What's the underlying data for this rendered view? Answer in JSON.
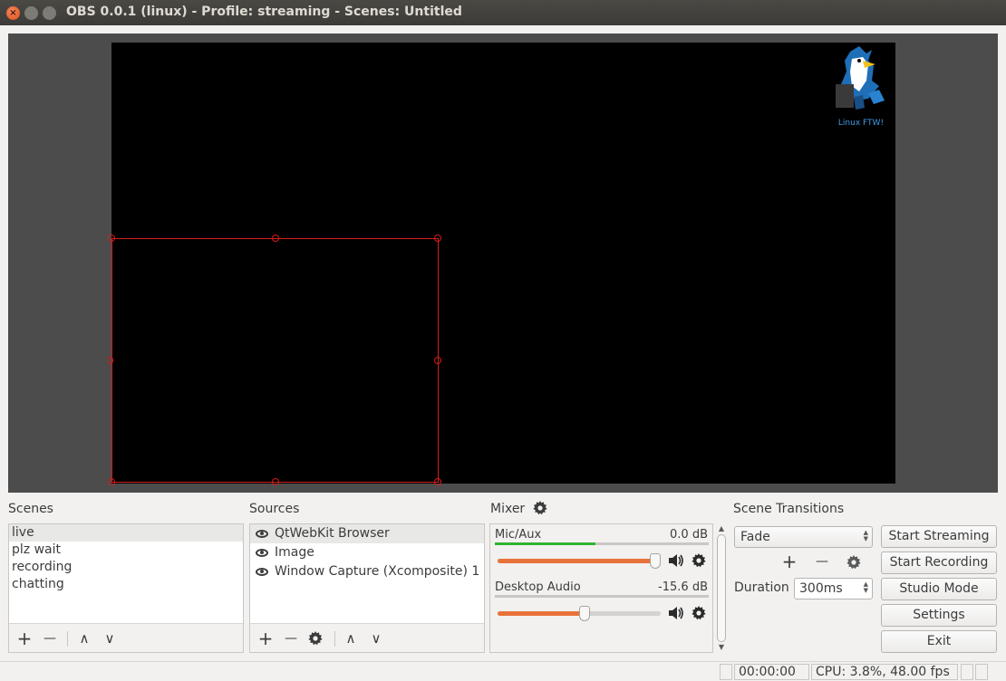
{
  "window": {
    "title": "OBS 0.0.1 (linux) - Profile: streaming - Scenes: Untitled",
    "close_glyph": "×",
    "minimize_glyph": "—",
    "maximize_glyph": "□"
  },
  "preview": {
    "logo_caption": "Linux FTW!",
    "selection_color": "#d41c1c"
  },
  "scenes": {
    "label": "Scenes",
    "items": [
      "live",
      "plz wait",
      "recording",
      "chatting"
    ],
    "selected": "live"
  },
  "sources": {
    "label": "Sources",
    "items": [
      "QtWebKit Browser",
      "Image",
      "Window Capture (Xcomposite) 1"
    ],
    "selected": "QtWebKit Browser"
  },
  "toolbar_glyphs": {
    "add": "+",
    "remove": "—",
    "up": "∧",
    "down": "∨"
  },
  "mixer": {
    "label": "Mixer",
    "channels": [
      {
        "name": "Mic/Aux",
        "db": "0.0 dB",
        "volume_fraction": 1.0,
        "meter_fraction": 0.47
      },
      {
        "name": "Desktop Audio",
        "db": "-15.6 dB",
        "volume_fraction": 0.55,
        "meter_fraction": 0.0
      }
    ],
    "slider_color": "#e8733a",
    "meter_color": "#2fb42f"
  },
  "transitions": {
    "label": "Scene Transitions",
    "selected": "Fade",
    "duration_label": "Duration",
    "duration_value": "300ms"
  },
  "controls": {
    "start_streaming": "Start Streaming",
    "start_recording": "Start Recording",
    "studio_mode": "Studio Mode",
    "settings": "Settings",
    "exit": "Exit"
  },
  "status": {
    "time": "00:00:00",
    "cpu": "CPU: 3.8%, 48.00 fps"
  }
}
